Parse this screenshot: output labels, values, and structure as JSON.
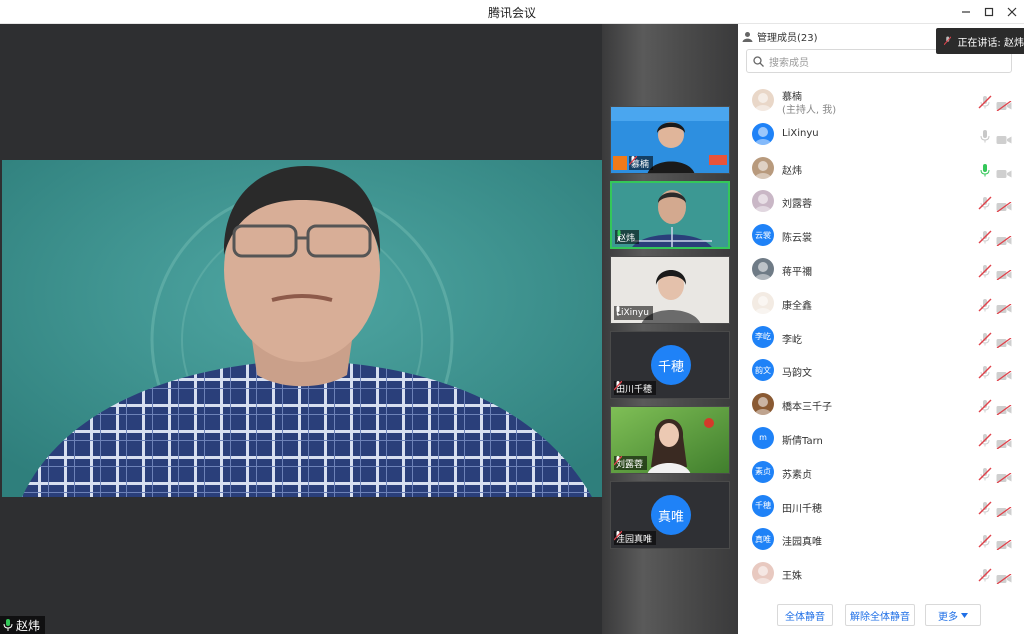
{
  "window": {
    "title": "腾讯会议"
  },
  "speaking_toast": {
    "label": "正在讲话: 赵炜"
  },
  "main_video": {
    "name": "赵炜"
  },
  "thumbnails": [
    {
      "name": "慕楠",
      "type": "video",
      "host": true
    },
    {
      "name": "赵炜",
      "type": "video",
      "active": true
    },
    {
      "name": "LiXinyu",
      "type": "video"
    },
    {
      "name": "田川千穂",
      "type": "avatar",
      "avatar_text": "千穂"
    },
    {
      "name": "刘露蓉",
      "type": "video"
    },
    {
      "name": "洼园真唯",
      "type": "avatar",
      "avatar_text": "真唯"
    }
  ],
  "panel": {
    "title": "管理成员(23)",
    "search_placeholder": "搜索成员",
    "members": [
      {
        "name": "慕楠",
        "role": "(主持人, 我)",
        "avatar": "photo",
        "avatar_color": "#e9d7c8",
        "mic": "muted"
      },
      {
        "name": "LiXinyu",
        "avatar": "photo",
        "avatar_color": "#1f82f7",
        "mic": "on"
      },
      {
        "name": "赵炜",
        "avatar": "photo",
        "avatar_color": "#b89a7d",
        "mic": "speaking"
      },
      {
        "name": "刘露蓉",
        "avatar": "photo",
        "avatar_color": "#c9b7c6",
        "mic": "muted"
      },
      {
        "name": "陈云裳",
        "avatar": "text",
        "avatar_text": "云裳",
        "avatar_color": "#1f82f7",
        "mic": "muted"
      },
      {
        "name": "蒋平禰",
        "avatar": "photo",
        "avatar_color": "#6f7b86",
        "mic": "muted"
      },
      {
        "name": "康全鑫",
        "avatar": "photo",
        "avatar_color": "#f3ebe3",
        "mic": "muted"
      },
      {
        "name": "李屹",
        "avatar": "text",
        "avatar_text": "李屹",
        "avatar_color": "#1f82f7",
        "mic": "muted"
      },
      {
        "name": "马韵文",
        "avatar": "text",
        "avatar_text": "韵文",
        "avatar_color": "#1f82f7",
        "mic": "muted"
      },
      {
        "name": "橋本三千子",
        "avatar": "photo",
        "avatar_color": "#8a5a33",
        "mic": "muted"
      },
      {
        "name": "斯倩Tarn",
        "avatar": "text",
        "avatar_text": "m",
        "avatar_color": "#1f82f7",
        "mic": "muted"
      },
      {
        "name": "苏素贞",
        "avatar": "text",
        "avatar_text": "素贞",
        "avatar_color": "#1f82f7",
        "mic": "muted"
      },
      {
        "name": "田川千穂",
        "avatar": "text",
        "avatar_text": "千穂",
        "avatar_color": "#1f82f7",
        "mic": "muted"
      },
      {
        "name": "洼园真唯",
        "avatar": "text",
        "avatar_text": "真唯",
        "avatar_color": "#1f82f7",
        "mic": "muted"
      },
      {
        "name": "王姝",
        "avatar": "photo",
        "avatar_color": "#e8c9c0",
        "mic": "muted"
      }
    ],
    "buttons": {
      "mute_all": "全体静音",
      "unmute_all": "解除全体静音",
      "more": "更多"
    }
  },
  "colors": {
    "accent": "#1f82f7",
    "speaking_green": "#34c759",
    "muted_red": "#e0424b"
  }
}
